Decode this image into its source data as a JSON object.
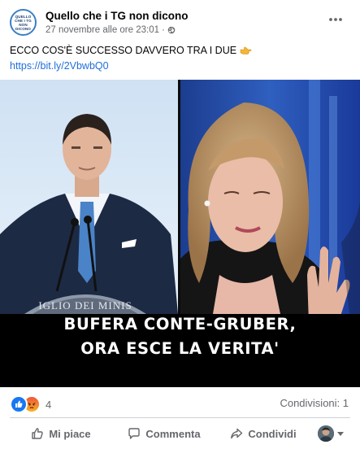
{
  "post": {
    "page_name": "Quello che i TG non dicono",
    "avatar_lines": [
      "QUELLO",
      "CHE I TG",
      "NON",
      "DICONO"
    ],
    "timestamp": "27 novembre alle ore 23:01",
    "separator": "·",
    "privacy_icon": "globe-icon",
    "more_icon": "more-options-icon",
    "text": "ECCO COS'È SUCCESSO DAVVERO TRA I DUE",
    "text_emoji": "pointing-hand-icon",
    "link": "https://bit.ly/2VbwbQ0"
  },
  "media": {
    "caption_line1": "BUFERA CONTE-GRUBER,",
    "caption_line2": "ORA ESCE LA VERITA'",
    "podium_text": "IGLIO DEI MINIS"
  },
  "stats": {
    "reactions": [
      "like",
      "angry"
    ],
    "reaction_count": "4",
    "shares": "Condivisioni: 1"
  },
  "actions": {
    "like": "Mi piace",
    "comment": "Commenta",
    "share": "Condividi"
  },
  "colors": {
    "link": "#216fdb",
    "like_blue": "#1877f2",
    "secondary_text": "#65676b"
  }
}
